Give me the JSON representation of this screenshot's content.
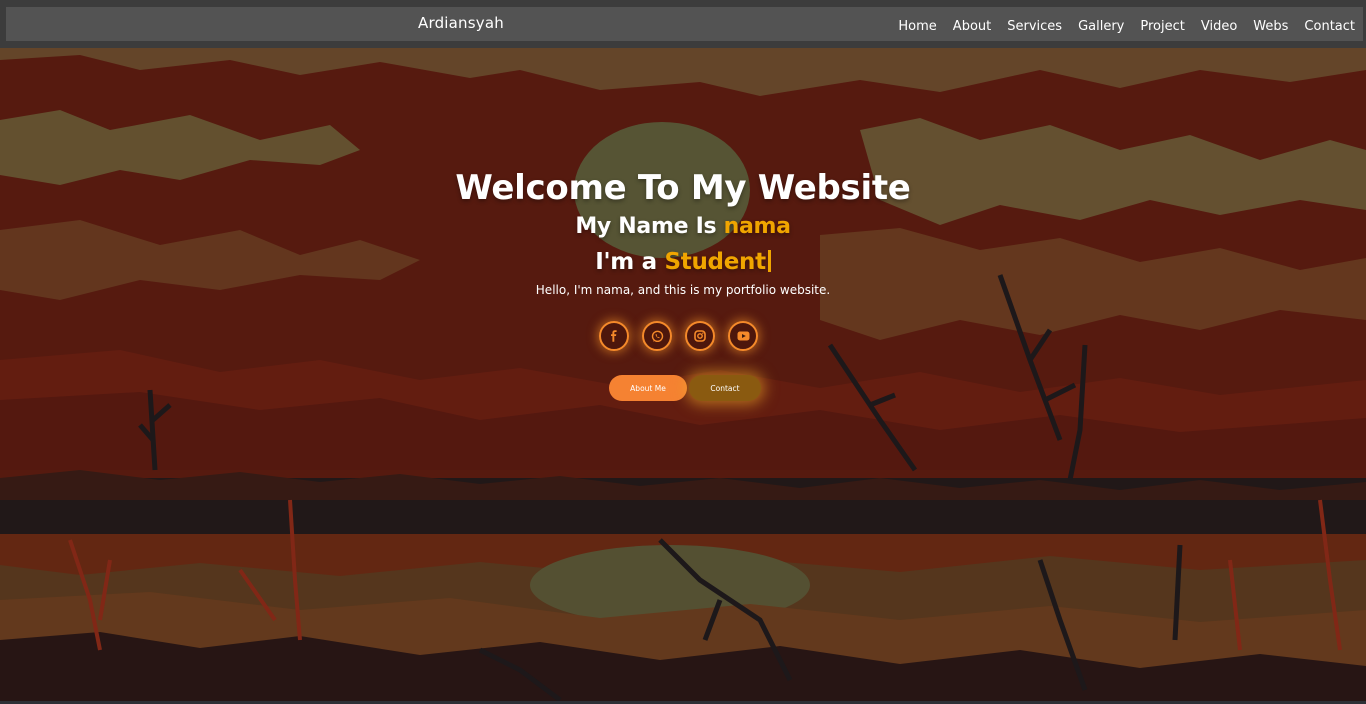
{
  "brand": "Ardiansyah",
  "nav": {
    "items": [
      {
        "label": "Home"
      },
      {
        "label": "About"
      },
      {
        "label": "Services"
      },
      {
        "label": "Gallery"
      },
      {
        "label": "Project"
      },
      {
        "label": "Video"
      },
      {
        "label": "Webs"
      },
      {
        "label": "Contact"
      }
    ]
  },
  "hero": {
    "title": "Welcome To My Website",
    "name_prefix": "My Name Is",
    "name": "nama",
    "role_prefix": "I'm a",
    "role": "Student",
    "tagline": "Hello, I'm nama, and this is my portfolio website."
  },
  "socials": [
    {
      "icon": "facebook-icon"
    },
    {
      "icon": "whatsapp-icon"
    },
    {
      "icon": "instagram-icon"
    },
    {
      "icon": "youtube-icon"
    }
  ],
  "buttons": {
    "about": "About Me",
    "contact": "Contact"
  },
  "colors": {
    "accent": "#f0a500",
    "orange": "#f58232",
    "navbar": "#535353"
  }
}
